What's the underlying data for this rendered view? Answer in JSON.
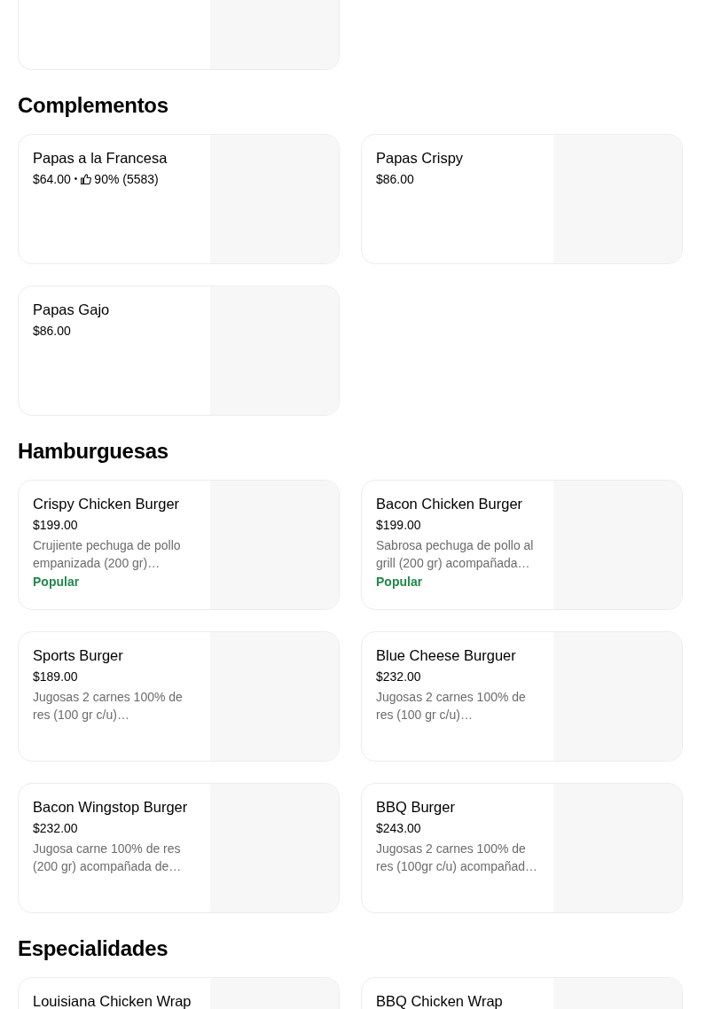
{
  "sections": [
    {
      "title": "Complementos",
      "items": [
        {
          "name": "Papas a la Francesa",
          "price": "$64.00",
          "separator": "•",
          "rating": "90% (5583)"
        },
        {
          "name": "Papas Crispy",
          "price": "$86.00"
        },
        {
          "name": "Papas Gajo",
          "price": "$86.00"
        }
      ]
    },
    {
      "title": "Hamburguesas",
      "items": [
        {
          "name": "Crispy Chicken Burger",
          "price": "$199.00",
          "description": "Crujiente pechuga de pollo empanizada (200 gr)…",
          "badge": "Popular"
        },
        {
          "name": "Bacon Chicken Burger",
          "price": "$199.00",
          "description": "Sabrosa pechuga de pollo al grill (200 gr) acompañada…",
          "badge": "Popular"
        },
        {
          "name": "Sports Burger",
          "price": "$189.00",
          "description": "Jugosas 2 carnes 100% de res (100 gr c/u)…"
        },
        {
          "name": "Blue Cheese Burguer",
          "price": "$232.00",
          "description": "Jugosas 2 carnes 100% de res (100 gr c/u)…"
        },
        {
          "name": "Bacon Wingstop Burger",
          "price": "$232.00",
          "description": "Jugosa carne 100% de res (200 gr) acompañada de…"
        },
        {
          "name": "BBQ Burger",
          "price": "$243.00",
          "description": "Jugosas 2 carnes 100% de res (100gr c/u) acompañad…"
        }
      ]
    },
    {
      "title": "Especialidades",
      "items": [
        {
          "name": "Louisiana Chicken Wrap"
        },
        {
          "name": "BBQ Chicken Wrap"
        }
      ]
    }
  ]
}
